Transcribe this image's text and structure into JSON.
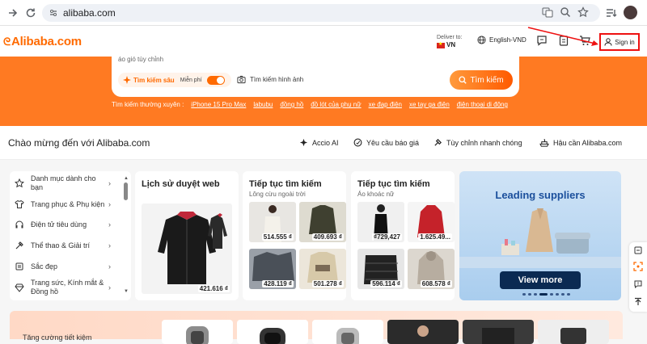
{
  "browser": {
    "url": "alibaba.com"
  },
  "header": {
    "logo": "Alibaba.com",
    "deliver_label": "Deliver to:",
    "deliver_country": "VN",
    "language": "English-VND",
    "signin": "Sign in"
  },
  "search": {
    "placeholder_text": "áo gió tùy chỉnh",
    "deep_search_label": "Tìm kiếm sâu",
    "free_label": "Miễn phí",
    "image_search_label": "Tìm kiếm hình ảnh",
    "search_button": "Tìm kiếm",
    "frequent_label": "Tìm kiếm thường xuyên :",
    "frequent_terms": [
      "iPhone 15 Pro Max",
      "labubu",
      "đồng hồ",
      "đồ lót của phụ nữ",
      "xe đạp điện",
      "xe tay ga điện",
      "điện thoại di động"
    ]
  },
  "welcome": {
    "title": "Chào mừng đến với Alibaba.com",
    "links": [
      "Accio AI",
      "Yêu cầu báo giá",
      "Tùy chỉnh nhanh chóng",
      "Hậu cần Alibaba.com"
    ]
  },
  "categories": [
    {
      "label": "Danh mục dành cho bạn",
      "icon": "star-icon"
    },
    {
      "label": "Trang phục & Phụ kiện",
      "icon": "shirt-icon"
    },
    {
      "label": "Điện tử tiêu dùng",
      "icon": "headphones-icon"
    },
    {
      "label": "Thể thao & Giải trí",
      "icon": "sports-icon"
    },
    {
      "label": "Sắc đẹp",
      "icon": "beauty-icon"
    },
    {
      "label": "Trang sức, Kính mắt & Đồng hồ",
      "icon": "gem-icon"
    }
  ],
  "browsing_history": {
    "title": "Lịch sử duyệt web",
    "price": "421.616 ₫"
  },
  "continue_1": {
    "title": "Tiếp tục tìm kiếm",
    "subtitle": "Lông cừu ngoài trời",
    "prices": [
      "514.555 ₫",
      "409.693 ₫",
      "428.119 ₫",
      "501.278 ₫"
    ]
  },
  "continue_2": {
    "title": "Tiếp tục tìm kiếm",
    "subtitle": "Áo khoác nữ",
    "prices": [
      "₫729,427",
      "1.625.49...",
      "596.114 ₫",
      "608.578 ₫"
    ]
  },
  "suppliers": {
    "title": "Leading suppliers",
    "button": "View more"
  },
  "bottom": {
    "title": "Tăng cường tiết kiệm"
  },
  "colors": {
    "brand": "#ff6a00",
    "hero": "#ff7a22",
    "annotation": "#ee1111"
  }
}
